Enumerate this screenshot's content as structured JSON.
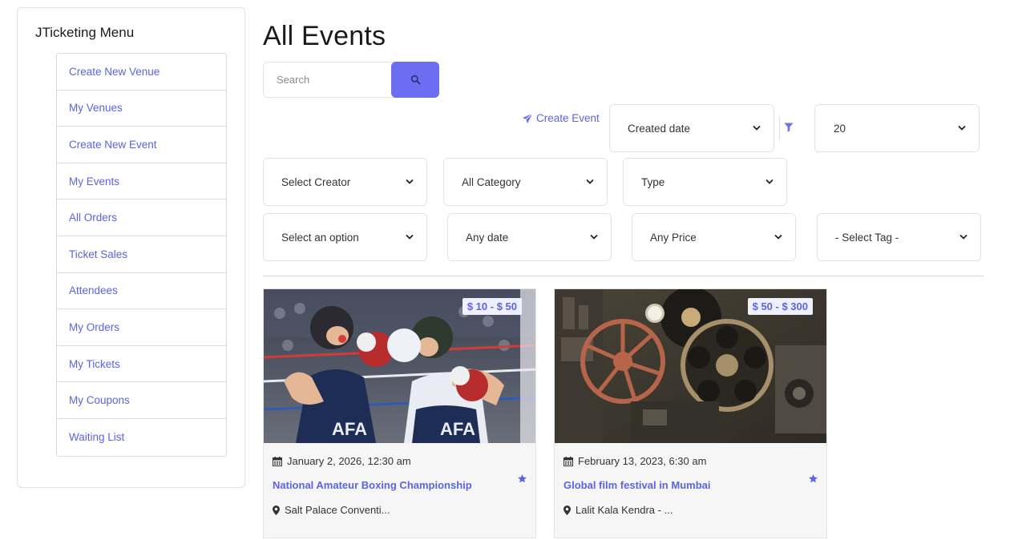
{
  "sidebar": {
    "title": "JTicketing Menu",
    "items": [
      {
        "label": "Create New Venue"
      },
      {
        "label": "My Venues"
      },
      {
        "label": "Create New Event"
      },
      {
        "label": "My Events"
      },
      {
        "label": "All Orders"
      },
      {
        "label": "Ticket Sales"
      },
      {
        "label": "Attendees"
      },
      {
        "label": "My Orders"
      },
      {
        "label": "My Tickets"
      },
      {
        "label": "My Coupons"
      },
      {
        "label": "Waiting List"
      }
    ]
  },
  "main": {
    "title": "All Events",
    "search": {
      "placeholder": "Search",
      "value": "",
      "button_icon": "search-icon"
    },
    "create_event": {
      "label": "Create Event",
      "icon": "paper-plane-icon"
    },
    "sort": {
      "selected": "Created date"
    },
    "limit": {
      "selected": "20"
    },
    "filters": {
      "creator": "Select Creator",
      "category": "All Category",
      "type": "Type",
      "option": "Select an option",
      "date": "Any date",
      "price": "Any Price",
      "tag": "- Select Tag -"
    }
  },
  "events": [
    {
      "price": "$ 10 - $ 50",
      "date": "January 2, 2026, 12:30 am",
      "title": "National Amateur Boxing Championship",
      "location": "Salt Palace Conventi..."
    },
    {
      "price": "$ 50 - $ 300",
      "date": "February 13, 2023, 6:30 am",
      "title": "Global film festival in Mumbai",
      "location": "Lalit Kala Kendra - ..."
    }
  ],
  "colors": {
    "accent": "#6b6ef0",
    "link": "#5b63e6",
    "border": "#e3e3e3"
  }
}
